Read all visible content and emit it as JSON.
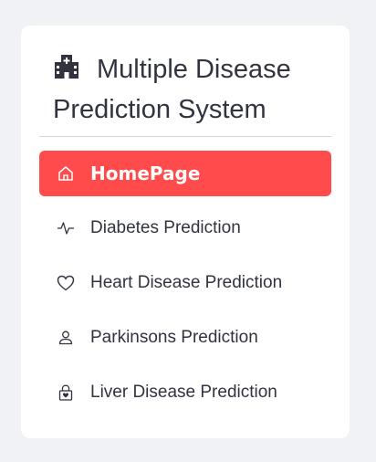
{
  "sidebar": {
    "title": "Multiple Disease Prediction System",
    "title_icon": "hospital-icon",
    "accent_color": "#ff4b4b",
    "items": [
      {
        "label": "HomePage",
        "icon": "house-icon",
        "active": true
      },
      {
        "label": "Diabetes Prediction",
        "icon": "activity-icon",
        "active": false
      },
      {
        "label": "Heart Disease Prediction",
        "icon": "heart-icon",
        "active": false
      },
      {
        "label": "Parkinsons Prediction",
        "icon": "person-icon",
        "active": false
      },
      {
        "label": "Liver Disease Prediction",
        "icon": "lock-heart-icon",
        "active": false
      }
    ]
  }
}
